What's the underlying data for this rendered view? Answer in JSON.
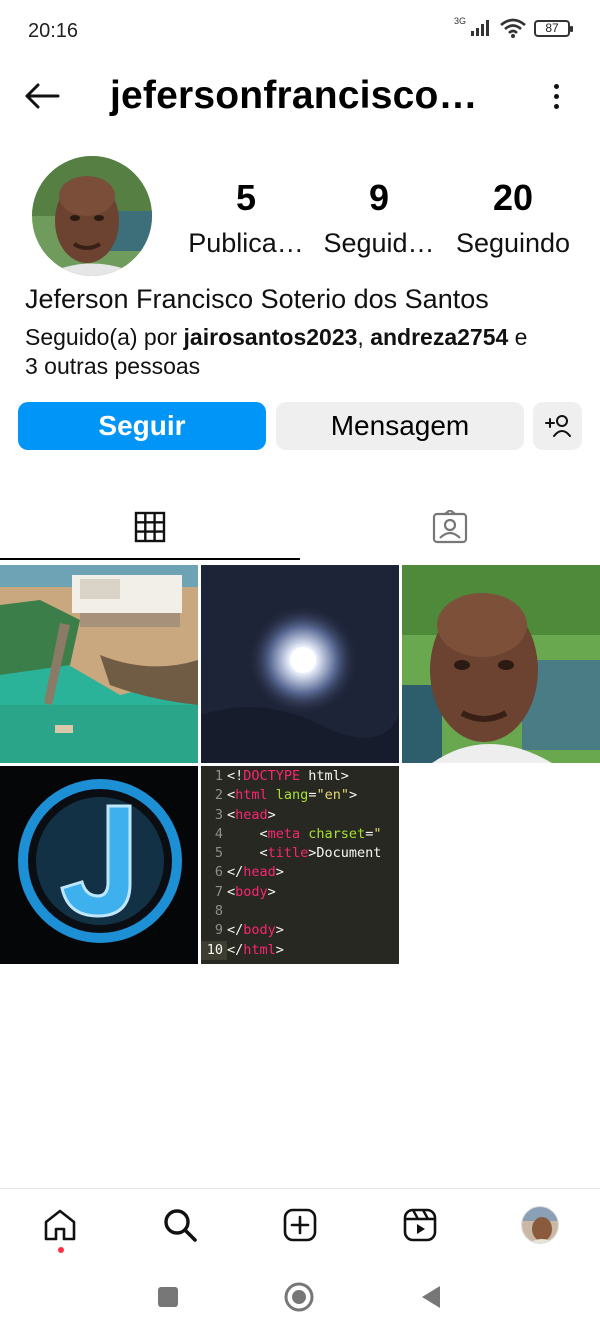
{
  "status_bar": {
    "time": "20:16",
    "network": "3G",
    "battery": "87"
  },
  "header": {
    "username": "jefersonfrancisco…"
  },
  "profile": {
    "stats": [
      {
        "value": "5",
        "label": "Publica…"
      },
      {
        "value": "9",
        "label": "Seguid…"
      },
      {
        "value": "20",
        "label": "Seguindo"
      }
    ],
    "full_name": "Jeferson Francisco Soterio dos Santos",
    "followed_by_prefix": "Seguido(a) por ",
    "followed_by_user1": "jairosantos2023",
    "followed_by_sep": ", ",
    "followed_by_user2": "andreza2754",
    "followed_by_suffix_1": " e",
    "followed_by_suffix_2": "3 outras pessoas"
  },
  "actions": {
    "follow_label": "Seguir",
    "message_label": "Mensagem"
  },
  "tabs": [
    {
      "icon": "grid-icon",
      "active": true
    },
    {
      "icon": "tagged-icon",
      "active": false
    }
  ],
  "posts": {
    "code_lines": [
      {
        "n": "1",
        "parts": [
          [
            "tok-plain",
            "<!"
          ],
          [
            "tok-tag",
            "DOCTYPE"
          ],
          [
            "tok-plain",
            " html>"
          ]
        ]
      },
      {
        "n": "2",
        "parts": [
          [
            "tok-plain",
            "<"
          ],
          [
            "tok-tag",
            "html"
          ],
          [
            "tok-plain",
            " "
          ],
          [
            "tok-attr",
            "lang"
          ],
          [
            "tok-plain",
            "="
          ],
          [
            "tok-str",
            "\"en\""
          ],
          [
            "tok-plain",
            ">"
          ]
        ]
      },
      {
        "n": "3",
        "parts": [
          [
            "tok-plain",
            "<"
          ],
          [
            "tok-tag",
            "head"
          ],
          [
            "tok-plain",
            ">"
          ]
        ]
      },
      {
        "n": "4",
        "parts": [
          [
            "tok-plain",
            "    <"
          ],
          [
            "tok-tag",
            "meta"
          ],
          [
            "tok-plain",
            " "
          ],
          [
            "tok-attr",
            "charset"
          ],
          [
            "tok-plain",
            "="
          ],
          [
            "tok-str",
            "\""
          ]
        ]
      },
      {
        "n": "5",
        "parts": [
          [
            "tok-plain",
            "    <"
          ],
          [
            "tok-tag",
            "title"
          ],
          [
            "tok-plain",
            ">Document"
          ]
        ]
      },
      {
        "n": "6",
        "parts": [
          [
            "tok-plain",
            "</"
          ],
          [
            "tok-tag",
            "head"
          ],
          [
            "tok-plain",
            ">"
          ]
        ]
      },
      {
        "n": "7",
        "parts": [
          [
            "tok-plain",
            "<"
          ],
          [
            "tok-tag",
            "body"
          ],
          [
            "tok-plain",
            ">"
          ]
        ]
      },
      {
        "n": "8",
        "parts": []
      },
      {
        "n": "9",
        "parts": [
          [
            "tok-plain",
            "</"
          ],
          [
            "tok-tag",
            "body"
          ],
          [
            "tok-plain",
            ">"
          ]
        ]
      },
      {
        "n": "10",
        "parts": [
          [
            "tok-plain",
            "</"
          ],
          [
            "tok-tag",
            "html"
          ],
          [
            "tok-plain",
            ">"
          ]
        ]
      }
    ]
  },
  "bottom_nav": [
    "home-icon",
    "search-icon",
    "create-icon",
    "reels-icon",
    "profile-avatar"
  ],
  "colors": {
    "accent": "#0095f6",
    "notification": "#ff3040"
  }
}
